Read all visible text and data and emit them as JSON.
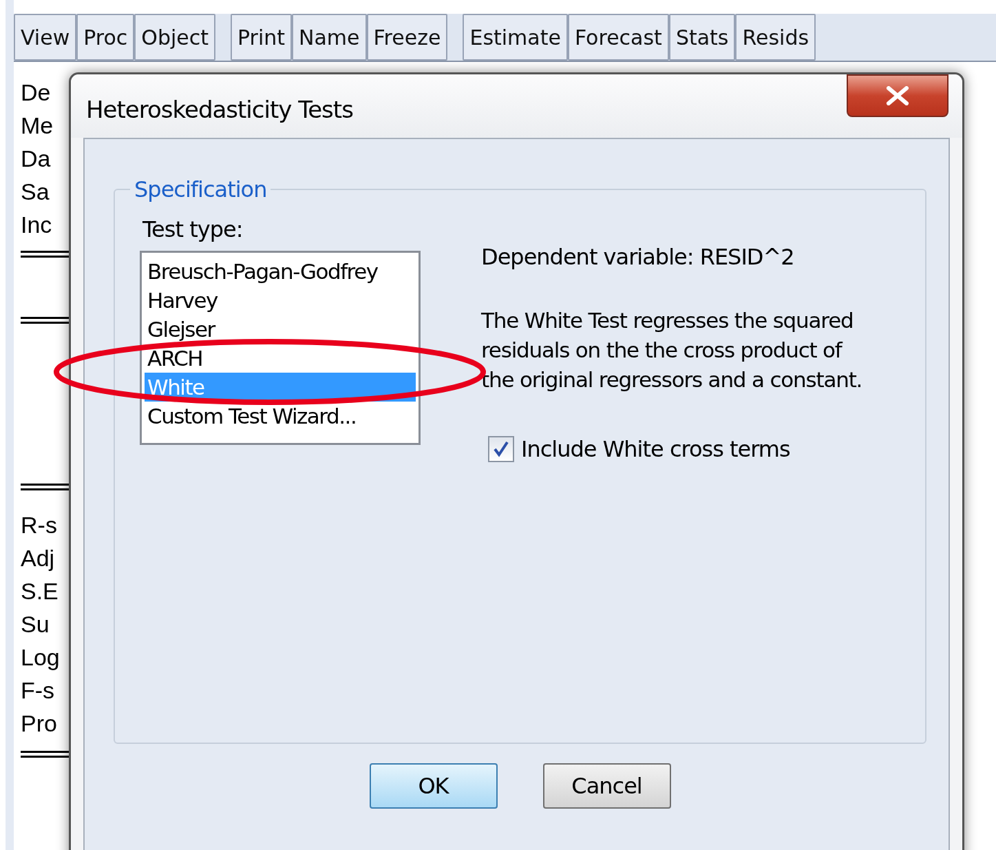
{
  "toolbar": {
    "groups": [
      [
        "View",
        "Proc",
        "Object"
      ],
      [
        "Print",
        "Name",
        "Freeze"
      ],
      [
        "Estimate",
        "Forecast",
        "Stats",
        "Resids"
      ]
    ]
  },
  "output": {
    "header_lines": [
      "De",
      "Me",
      "Da",
      "Sa",
      "Inc"
    ],
    "stat_lines": [
      "R-s",
      "Adj",
      "S.E",
      "Su",
      "Log",
      "F-s",
      "Pro"
    ]
  },
  "dialog": {
    "title": "Heteroskedasticity Tests",
    "group_title": "Specification",
    "test_type_label": "Test type:",
    "test_types": [
      {
        "label": "Breusch-Pagan-Godfrey",
        "selected": false
      },
      {
        "label": "Harvey",
        "selected": false
      },
      {
        "label": "Glejser",
        "selected": false
      },
      {
        "label": "ARCH",
        "selected": false
      },
      {
        "label": "White",
        "selected": true
      },
      {
        "label": "Custom Test Wizard...",
        "selected": false
      }
    ],
    "dependent_variable": "Dependent variable: RESID^2",
    "description_lines": [
      "The White Test regresses the squared",
      "residuals on the the cross product of",
      "the original regressors and a constant."
    ],
    "checkbox": {
      "label": "Include White cross terms",
      "checked": true
    },
    "buttons": [
      {
        "label": "OK",
        "default": true
      },
      {
        "label": "Cancel",
        "default": false
      }
    ]
  },
  "annotation": {
    "kind": "ellipse"
  }
}
